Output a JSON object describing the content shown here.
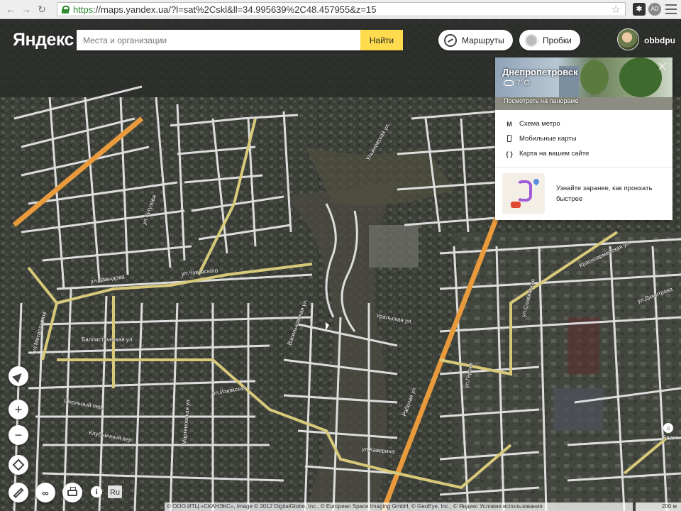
{
  "browser": {
    "url_https": "https",
    "url_rest": "://maps.yandex.ua/?l=sat%2Cskl&ll=34.995639%2C48.457955&z=15",
    "ext_label": "AD"
  },
  "header": {
    "logo": "Яндекс",
    "search_placeholder": "Места и организации",
    "search_button": "Найти",
    "routes_label": "Маршруты",
    "traffic_label": "Пробки",
    "username": "obbdpu"
  },
  "panel": {
    "city": "Днепропетровск",
    "temperature": "7°C",
    "panorama_link": "Посмотреть на панораме",
    "links": [
      {
        "icon": "М",
        "label": "Схема метро"
      },
      {
        "icon": "phone",
        "label": "Мобильные карты"
      },
      {
        "icon": "{ }",
        "label": "Карта на вашем сайте"
      }
    ],
    "promo_text": "Узнайте заранее, как проехать быстрее"
  },
  "map": {
    "controls": {
      "zoom_in": "+",
      "zoom_out": "−",
      "lang": "Ru"
    },
    "street_labels": [
      "ул.Давыдова",
      "ул.Чуковского",
      "Баллистическая ул.",
      "ул.Металлургов",
      "ул.Кутузова",
      "Уральская ул.",
      "Рабочая ул.",
      "Школьный пер.",
      "Клубничный пер.",
      "ул.Каверина",
      "ул.Изюмская",
      "Васильковская ул.",
      "ул.Героев",
      "Мартеновская ул.",
      "Красноармейская ул.",
      "ул.Димитрова",
      "ул.Славянская",
      "Ульяновская ул."
    ],
    "poi_label": "Авиас",
    "scale": "200 м",
    "copyright": "© ООО ИТЦ «СКАНЭКС», Image © 2012 DigitalGlobe, Inc., © European Space Imaging GmbH, © GeoEye, Inc., © Яндекс Условия использования"
  },
  "colors": {
    "accent_yellow": "#ffdb4d",
    "road_orange": "#e89a3c",
    "road_yellow": "#d8c97a",
    "road_white": "#f0f0f0"
  }
}
